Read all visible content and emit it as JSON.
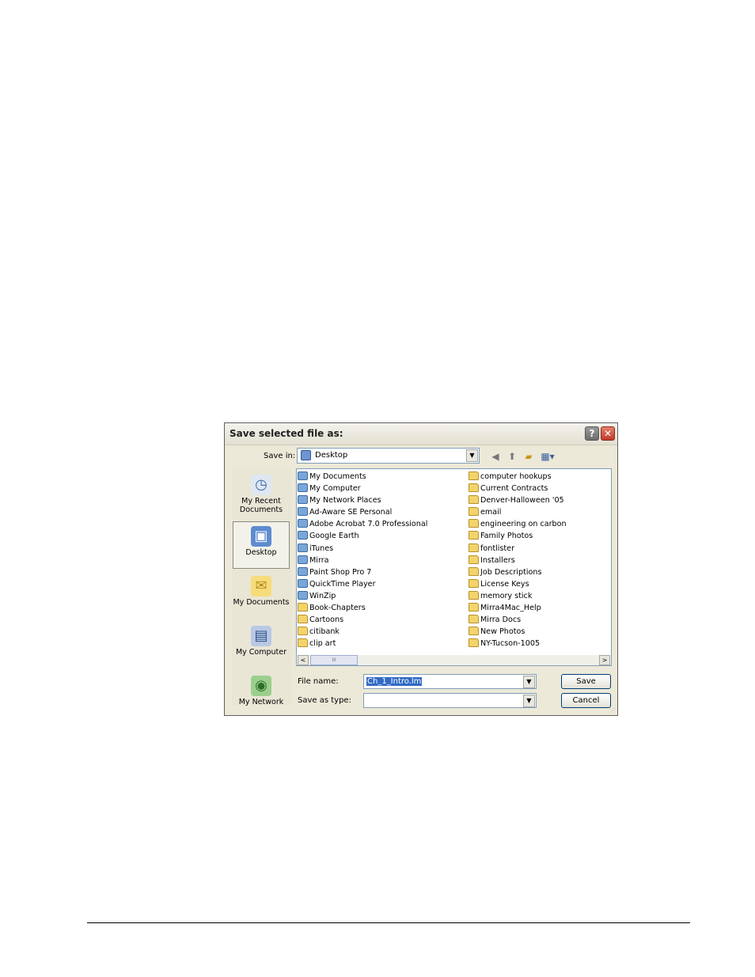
{
  "dialog": {
    "title": "Save selected file as:",
    "help_button": "?",
    "close_button": "✕"
  },
  "toolbar": {
    "save_in_label": "Save in:",
    "save_in_value": "Desktop"
  },
  "places": [
    {
      "line1": "My Recent",
      "line2": "Documents",
      "icon": "recent-documents-icon"
    },
    {
      "line1": "Desktop",
      "line2": "",
      "icon": "desktop-icon"
    },
    {
      "line1": "My Documents",
      "line2": "",
      "icon": "my-documents-icon"
    },
    {
      "line1": "My Computer",
      "line2": "",
      "icon": "my-computer-icon"
    },
    {
      "line1": "My Network",
      "line2": "",
      "icon": "my-network-icon"
    }
  ],
  "files_col1": [
    {
      "name": "My Documents",
      "kind": "app"
    },
    {
      "name": "My Computer",
      "kind": "app"
    },
    {
      "name": "My Network Places",
      "kind": "app"
    },
    {
      "name": "Ad-Aware SE Personal",
      "kind": "app"
    },
    {
      "name": "Adobe Acrobat 7.0 Professional",
      "kind": "app"
    },
    {
      "name": "Google Earth",
      "kind": "app"
    },
    {
      "name": "iTunes",
      "kind": "app"
    },
    {
      "name": "Mirra",
      "kind": "app"
    },
    {
      "name": "Paint Shop Pro 7",
      "kind": "app"
    },
    {
      "name": "QuickTime Player",
      "kind": "app"
    },
    {
      "name": "WinZip",
      "kind": "app"
    },
    {
      "name": "Book-Chapters",
      "kind": "folder"
    },
    {
      "name": "Cartoons",
      "kind": "folder"
    },
    {
      "name": "citibank",
      "kind": "folder"
    },
    {
      "name": "clip art",
      "kind": "folder"
    }
  ],
  "files_col2": [
    {
      "name": "computer hookups",
      "kind": "folder"
    },
    {
      "name": "Current Contracts",
      "kind": "folder"
    },
    {
      "name": "Denver-Halloween '05",
      "kind": "folder"
    },
    {
      "name": "email",
      "kind": "folder"
    },
    {
      "name": "engineering on carbon",
      "kind": "folder"
    },
    {
      "name": "Family Photos",
      "kind": "folder"
    },
    {
      "name": "fontlister",
      "kind": "folder"
    },
    {
      "name": "Installers",
      "kind": "folder"
    },
    {
      "name": "Job Descriptions",
      "kind": "folder"
    },
    {
      "name": "License Keys",
      "kind": "folder"
    },
    {
      "name": "memory stick",
      "kind": "folder"
    },
    {
      "name": "Mirra4Mac_Help",
      "kind": "folder"
    },
    {
      "name": "Mirra Docs",
      "kind": "folder"
    },
    {
      "name": "New Photos",
      "kind": "folder"
    },
    {
      "name": "NY-Tucson-1005",
      "kind": "folder"
    }
  ],
  "form": {
    "file_name_label": "File name:",
    "file_name_value": "Ch_1_Intro.lm",
    "save_as_type_label": "Save as type:",
    "save_as_type_value": "",
    "save_button": "Save",
    "cancel_button": "Cancel"
  },
  "scrollbar": {
    "left": "<",
    "right": ">",
    "grip": "III"
  }
}
